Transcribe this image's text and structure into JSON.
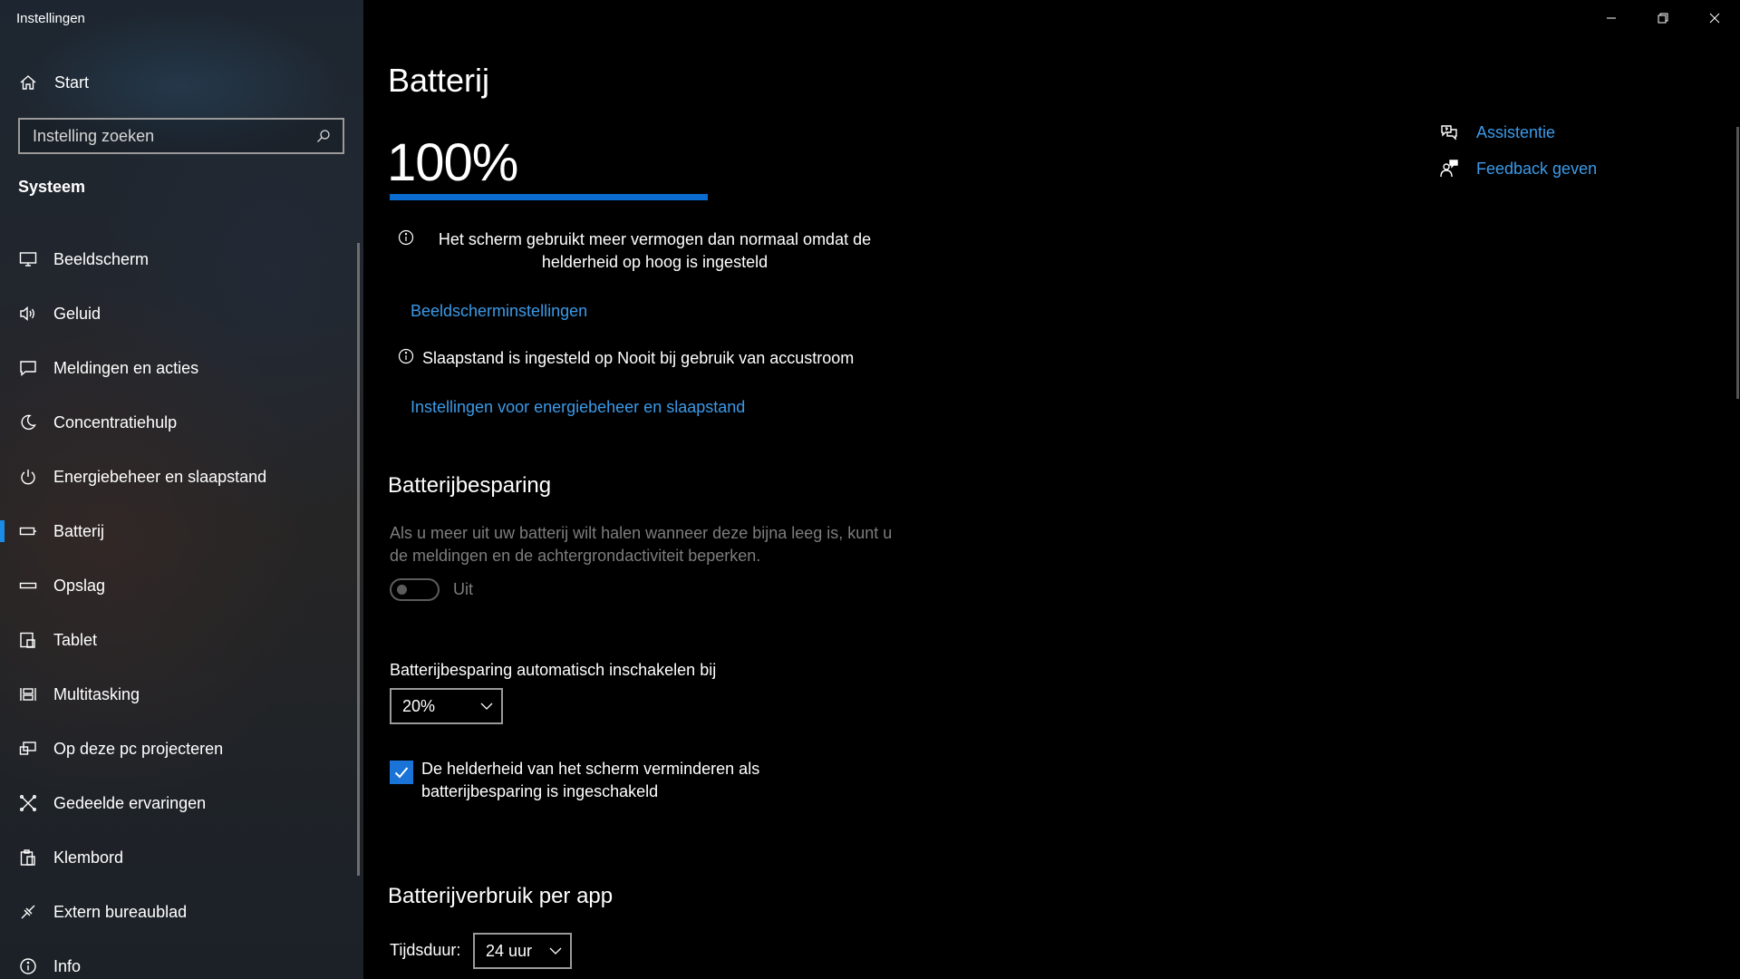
{
  "window": {
    "title": "Instellingen"
  },
  "sidebar": {
    "home_label": "Start",
    "search_placeholder": "Instelling zoeken",
    "section": "Systeem",
    "items": [
      {
        "label": "Beeldscherm",
        "icon": "monitor-icon"
      },
      {
        "label": "Geluid",
        "icon": "speaker-icon"
      },
      {
        "label": "Meldingen en acties",
        "icon": "notification-icon"
      },
      {
        "label": "Concentratiehulp",
        "icon": "moon-icon"
      },
      {
        "label": "Energiebeheer en slaapstand",
        "icon": "power-icon"
      },
      {
        "label": "Batterij",
        "icon": "battery-icon",
        "active": true
      },
      {
        "label": "Opslag",
        "icon": "storage-icon"
      },
      {
        "label": "Tablet",
        "icon": "tablet-icon"
      },
      {
        "label": "Multitasking",
        "icon": "multitasking-icon"
      },
      {
        "label": "Op deze pc projecteren",
        "icon": "project-icon"
      },
      {
        "label": "Gedeelde ervaringen",
        "icon": "shared-icon"
      },
      {
        "label": "Klembord",
        "icon": "clipboard-icon"
      },
      {
        "label": "Extern bureaublad",
        "icon": "remote-desktop-icon"
      },
      {
        "label": "Info",
        "icon": "info-icon"
      }
    ]
  },
  "main": {
    "title": "Batterij",
    "battery": {
      "percent_text": "100%",
      "level": 1.0,
      "bar_color": "#0a6bd0"
    },
    "notice_screen": "Het scherm gebruikt meer vermogen dan normaal omdat de helderheid op hoog is ingesteld",
    "link_display": "Beeldscherminstellingen",
    "notice_sleep": "Slaapstand is ingesteld op Nooit bij gebruik van accustroom",
    "link_power": "Instellingen voor energiebeheer en slaapstand",
    "saver": {
      "heading": "Batterijbesparing",
      "description": "Als u meer uit uw batterij wilt halen wanneer deze bijna leeg is, kunt u de meldingen en de achtergrondactiviteit beperken.",
      "toggle_state": "Uit",
      "toggle_on": false,
      "auto_label": "Batterijbesparing automatisch inschakelen bij",
      "auto_value": "20%",
      "brightness_label": "De helderheid van het scherm verminderen als batterijbesparing is ingeschakeld",
      "brightness_checked": true
    },
    "usage": {
      "heading": "Batterijverbruik per app",
      "duration_label": "Tijdsduur:",
      "duration_value": "24 uur"
    }
  },
  "aside": {
    "help_label": "Assistentie",
    "feedback_label": "Feedback geven"
  },
  "colors": {
    "accent": "#1a8ce8",
    "link": "#3b9ae8",
    "checkbox": "#1a73d6"
  }
}
